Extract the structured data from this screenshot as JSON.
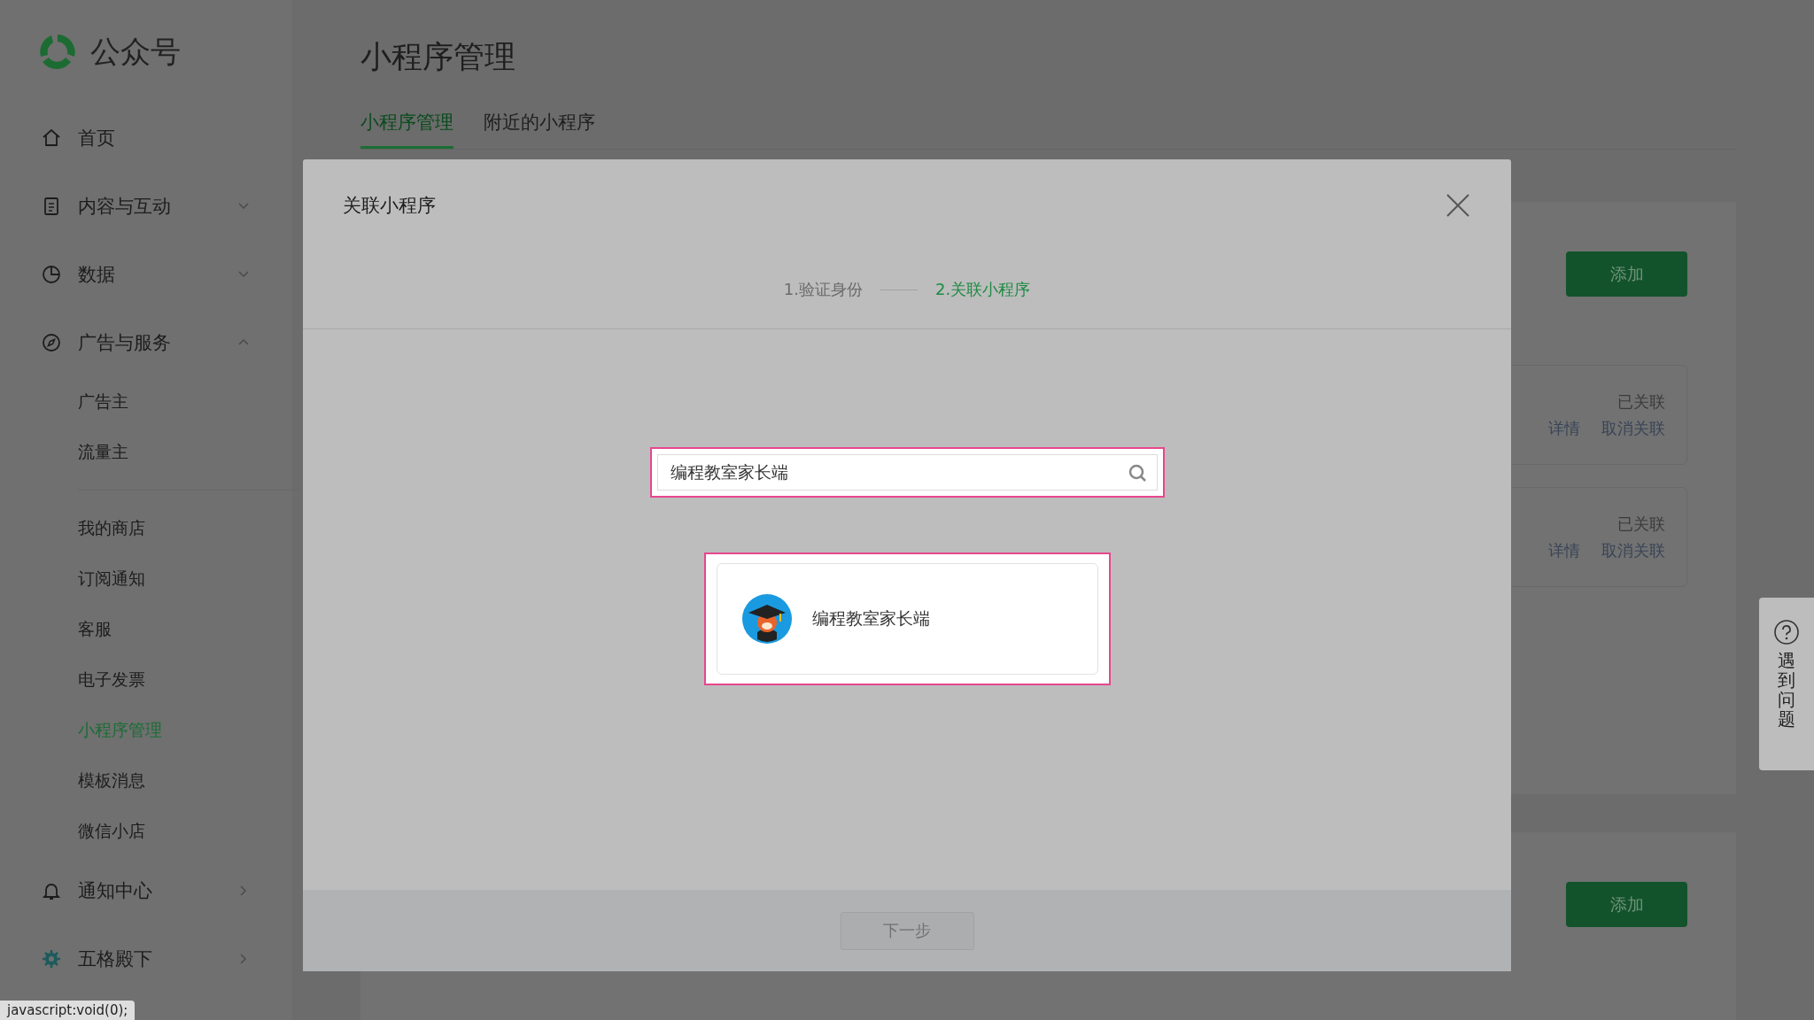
{
  "logo": {
    "text": "公众号"
  },
  "sidebar": {
    "items": [
      {
        "kind": "plain",
        "label": "首页"
      },
      {
        "kind": "group",
        "label": "内容与互动",
        "expanded": false
      },
      {
        "kind": "group",
        "label": "数据",
        "expanded": false
      },
      {
        "kind": "group",
        "label": "广告与服务",
        "expanded": true,
        "sections": [
          {
            "items": [
              {
                "label": "广告主",
                "selected": false
              },
              {
                "label": "流量主",
                "selected": false
              }
            ]
          },
          {
            "items": [
              {
                "label": "我的商店",
                "selected": false
              },
              {
                "label": "订阅通知",
                "selected": false
              },
              {
                "label": "客服",
                "selected": false
              },
              {
                "label": "电子发票",
                "selected": false
              },
              {
                "label": "小程序管理",
                "selected": true
              },
              {
                "label": "模板消息",
                "selected": false
              },
              {
                "label": "微信小店",
                "selected": false
              }
            ]
          }
        ]
      },
      {
        "kind": "link",
        "label": "通知中心"
      },
      {
        "kind": "link",
        "label": "五格殿下"
      }
    ]
  },
  "page": {
    "title": "小程序管理",
    "tabs": [
      {
        "label": "小程序管理",
        "selected": true
      },
      {
        "label": "附近的小程序",
        "selected": false
      }
    ],
    "panels": [
      {
        "add_button": "添加",
        "cards": [
          {
            "status": "已关联",
            "actions": [
              "详情",
              "取消关联"
            ]
          },
          {
            "status": "已关联",
            "actions": [
              "详情",
              "取消关联"
            ]
          }
        ]
      },
      {
        "add_button": "添加"
      }
    ]
  },
  "modal": {
    "title": "关联小程序",
    "steps": [
      {
        "label": "1.验证身份",
        "selected": false
      },
      {
        "label": "2.关联小程序",
        "selected": true
      }
    ],
    "search": {
      "value": "编程教室家长端"
    },
    "results": [
      {
        "name": "编程教室家长端"
      }
    ],
    "next_button": {
      "label": "下一步",
      "disabled": true
    }
  },
  "help": {
    "label": "遇到问题"
  },
  "status_bar": {
    "text": "javascript:void(0);"
  }
}
